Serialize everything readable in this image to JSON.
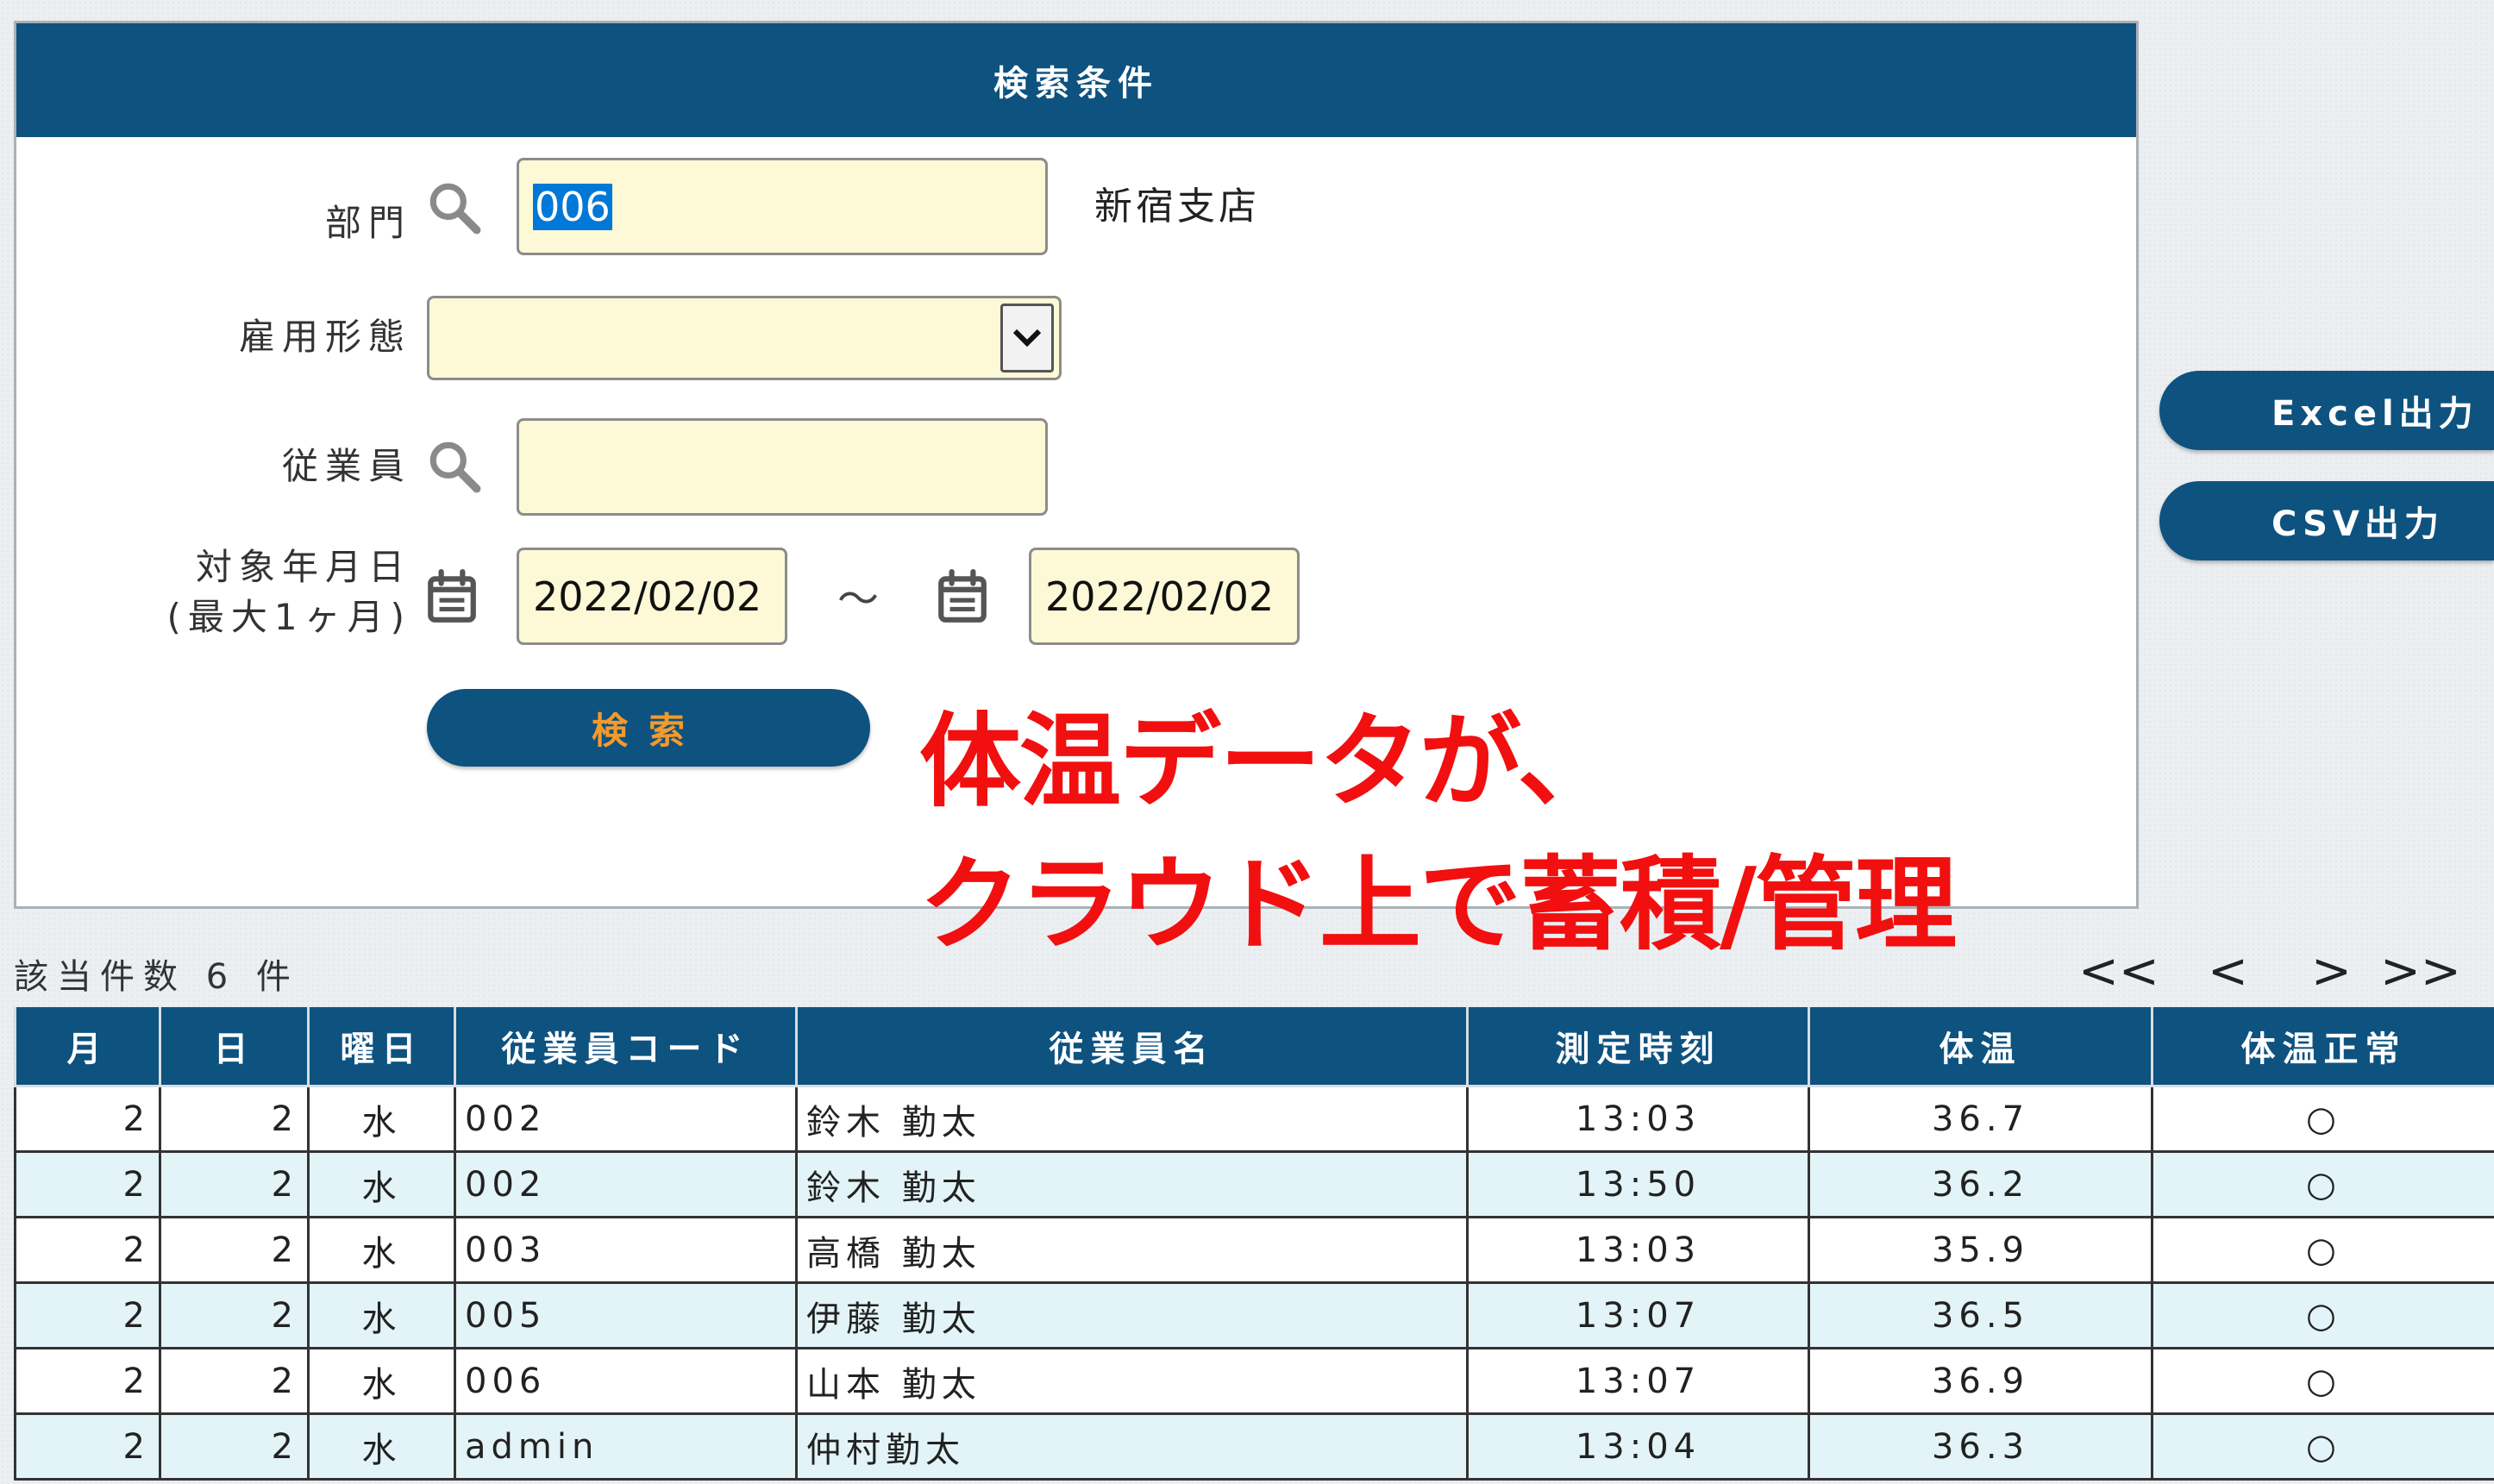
{
  "search_panel": {
    "title": "検索条件",
    "department": {
      "label": "部門",
      "value": "006",
      "name": "新宿支店"
    },
    "employment_type": {
      "label": "雇用形態",
      "value": ""
    },
    "employee": {
      "label": "従業員",
      "value": ""
    },
    "target_date": {
      "label_line1": "対象年月日",
      "label_line2": "(最大1ヶ月)",
      "from": "2022/02/02",
      "separator": "～",
      "to": "2022/02/02"
    },
    "search_button": "検索"
  },
  "export": {
    "excel_label": "Excel出力",
    "csv_label": "CSV出力"
  },
  "caption": {
    "line1": "体温データが、",
    "line2": "クラウド上で蓄積/管理"
  },
  "results": {
    "count_text": "該当件数 6 件",
    "pager": {
      "first": "<<",
      "prev": "<",
      "next": ">",
      "last": ">>"
    },
    "columns": [
      "月",
      "日",
      "曜日",
      "従業員コード",
      "従業員名",
      "測定時刻",
      "体温",
      "体温正常"
    ],
    "rows": [
      [
        "2",
        "2",
        "水",
        "002",
        "鈴木 勤太",
        "13:03",
        "36.7",
        "○"
      ],
      [
        "2",
        "2",
        "水",
        "002",
        "鈴木 勤太",
        "13:50",
        "36.2",
        "○"
      ],
      [
        "2",
        "2",
        "水",
        "003",
        "高橋 勤太",
        "13:03",
        "35.9",
        "○"
      ],
      [
        "2",
        "2",
        "水",
        "005",
        "伊藤 勤太",
        "13:07",
        "36.5",
        "○"
      ],
      [
        "2",
        "2",
        "水",
        "006",
        "山本 勤太",
        "13:07",
        "36.9",
        "○"
      ],
      [
        "2",
        "2",
        "水",
        "admin",
        "仲村勤太",
        "13:04",
        "36.3",
        "○"
      ]
    ]
  },
  "icons": {
    "search": "magnifier-icon",
    "calendar": "calendar-icon",
    "dropdown": "chevron-down-icon"
  },
  "colors": {
    "header_bg": "#0e5280",
    "input_bg": "#fdf9d6",
    "search_label": "#f39a2a",
    "caption": "#f20f0f",
    "row_alt": "#e3f4f8"
  }
}
